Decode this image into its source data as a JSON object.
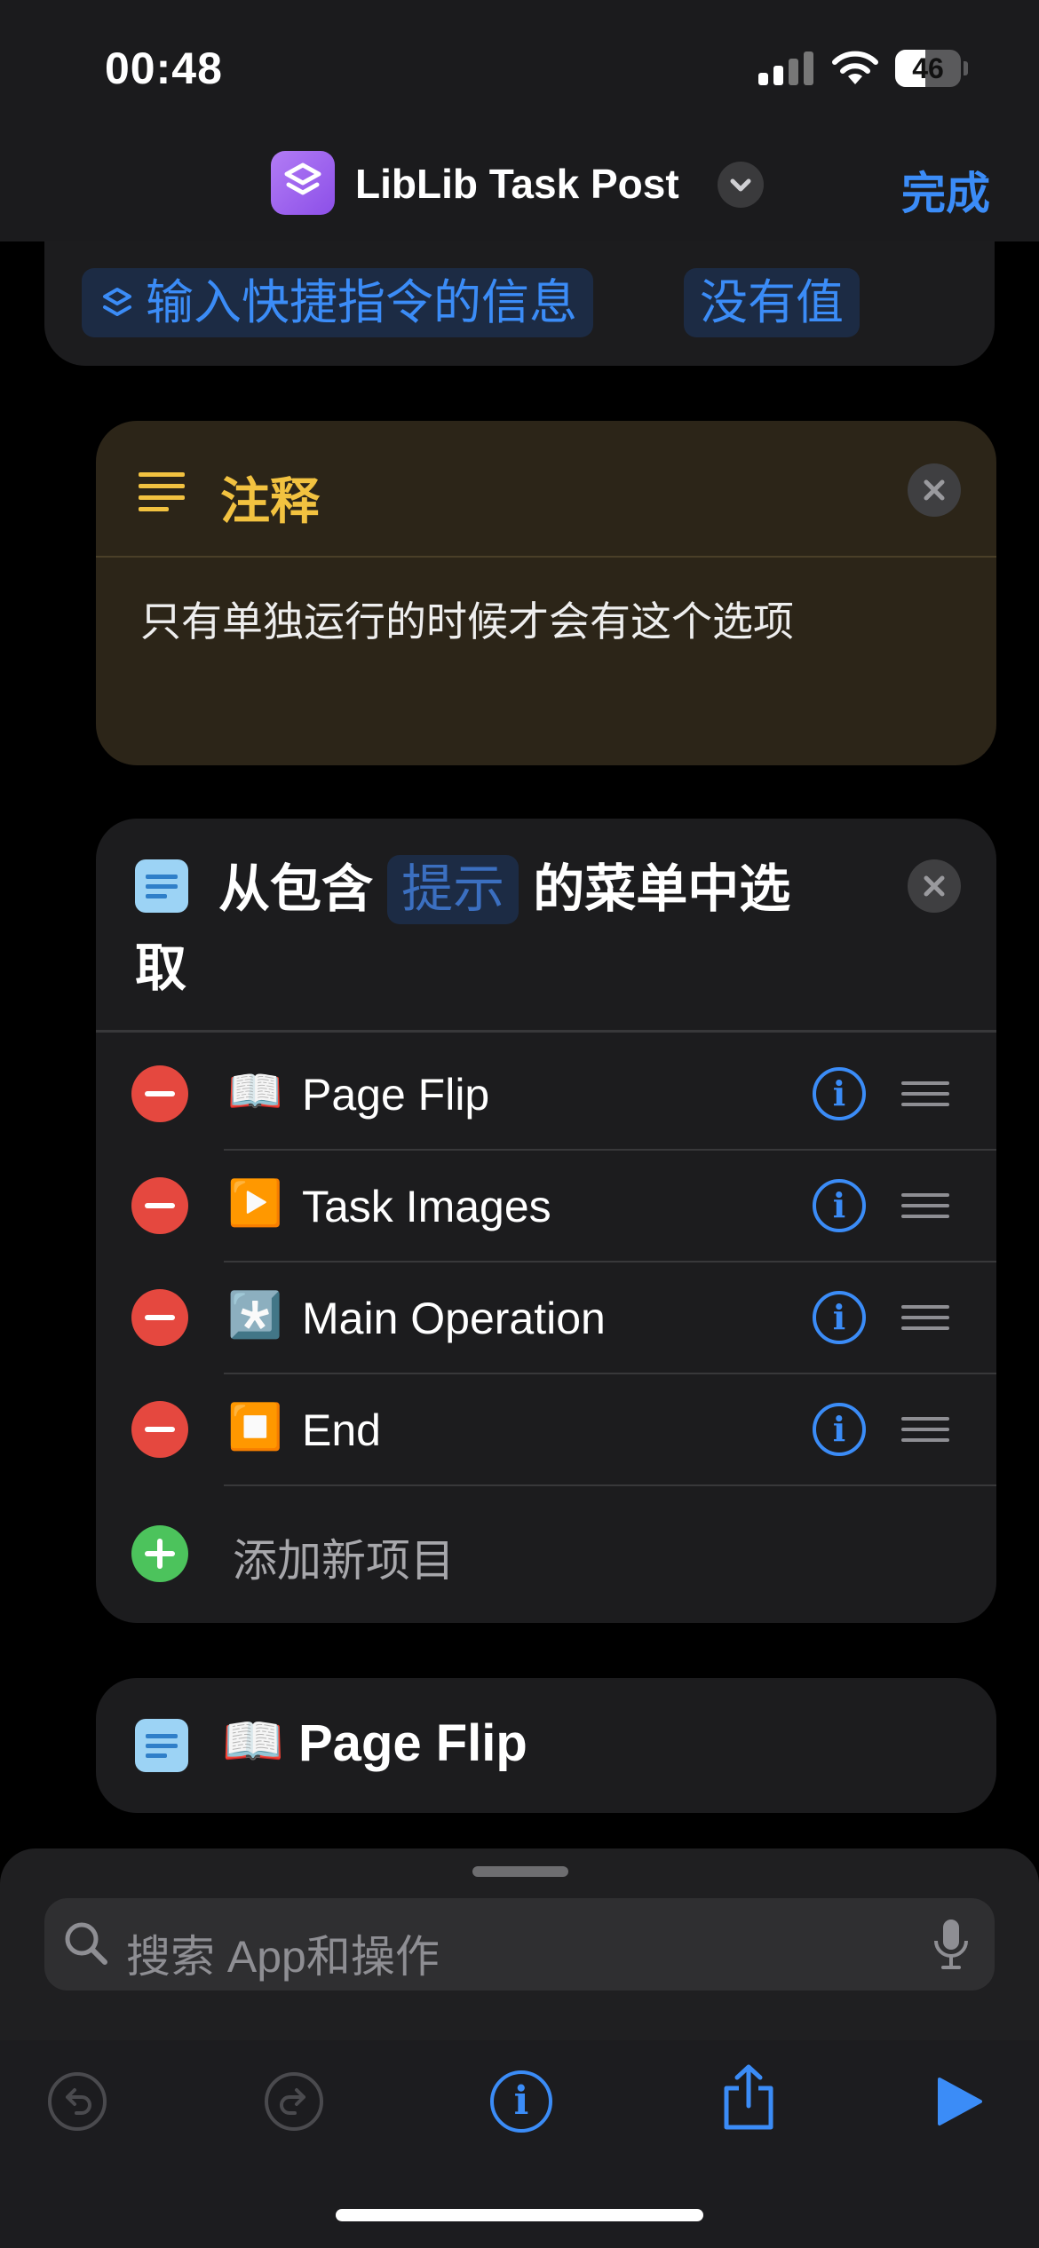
{
  "status_bar": {
    "time": "00:48",
    "battery": "46",
    "battery_level": 0.46
  },
  "nav": {
    "title": "LibLib Task Post",
    "done_label": "完成",
    "app_icon": "layers-icon"
  },
  "previous_action": {
    "token_input": "输入快捷指令的信息",
    "token_value": "没有值"
  },
  "comment": {
    "title": "注释",
    "text": "只有单独运行的时候才会有这个选项"
  },
  "menu_action": {
    "title_before": "从包含",
    "title_token": "提示",
    "title_after": "的菜单中选",
    "title_wrap": "取",
    "items": [
      {
        "emoji": "📖",
        "label": "Page Flip"
      },
      {
        "emoji": "▶️",
        "label": "Task Images"
      },
      {
        "emoji": "*️⃣",
        "label": "Main Operation"
      },
      {
        "emoji": "⏹️",
        "label": "End"
      }
    ],
    "add_label": "添加新项目"
  },
  "next_action": {
    "emoji": "📖",
    "label": "Page Flip"
  },
  "search": {
    "placeholder": "搜索 App和操作"
  },
  "colors": {
    "accent": "#3b8cf7",
    "comment_title": "#f2c240",
    "delete": "#e5483f",
    "add": "#4cc35c"
  }
}
